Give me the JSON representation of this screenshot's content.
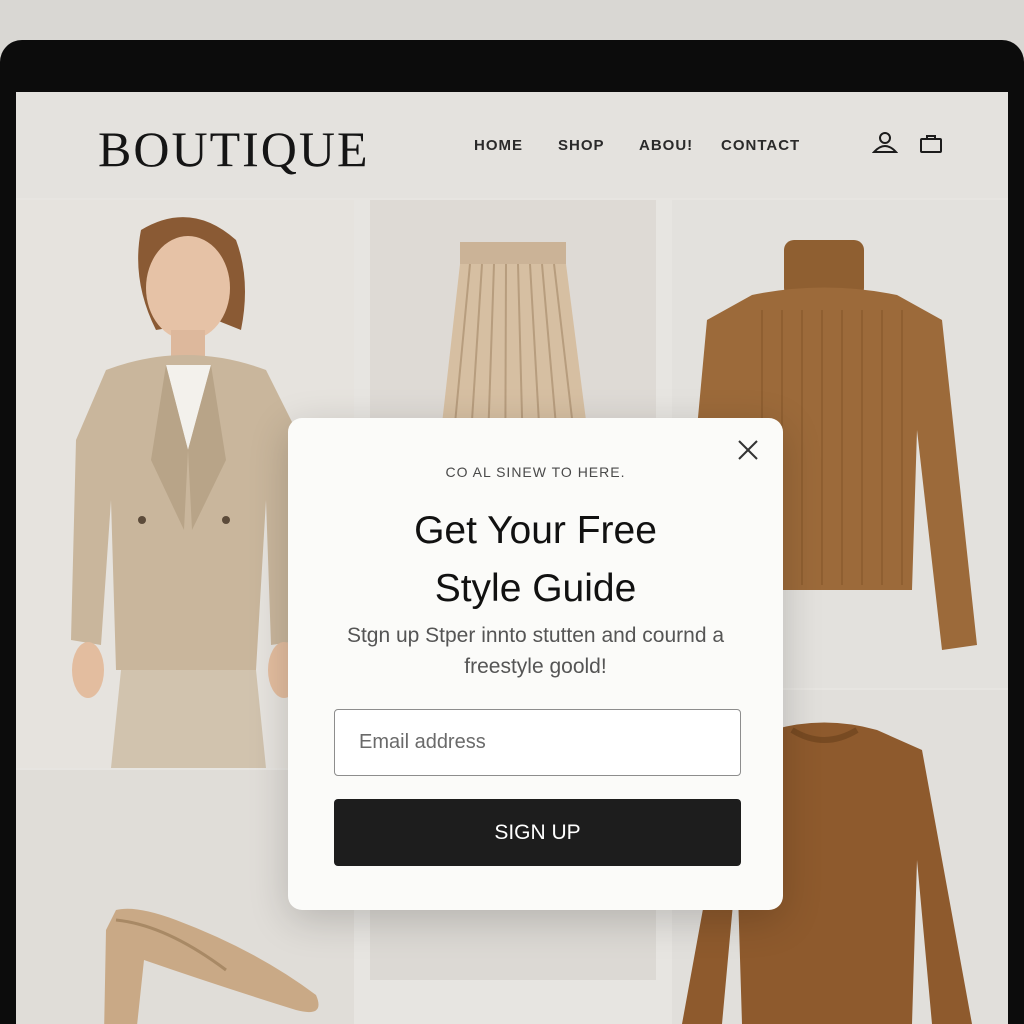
{
  "header": {
    "logo": "BOUTIQUE",
    "nav": [
      {
        "label": "HOME"
      },
      {
        "label": "SHOP"
      },
      {
        "label": "ABOU!"
      },
      {
        "label": "CONTACT"
      }
    ],
    "icons": [
      "account-icon",
      "cart-icon"
    ]
  },
  "products": [
    {
      "icon": "model-blazer-image"
    },
    {
      "icon": "pleated-skirt-image"
    },
    {
      "icon": "turtleneck-sweater-image"
    },
    {
      "icon": "pump-shoe-image"
    },
    {
      "icon": "crewneck-sweater-image"
    }
  ],
  "modal": {
    "eyebrow": "CO AL SINEW TO HERE.",
    "title": "Get Your Free\nStyle Guide",
    "subtitle": "Stgn up Stper innto stutten and cournd a freestyle goold!",
    "email_placeholder": "Email address",
    "button_label": "SIGN UP",
    "close_icon": "close-icon"
  },
  "colors": {
    "button": "#1d1d1d",
    "beige": "#c9b69c",
    "camel": "#9c6a3a",
    "background": "#e7e5e1"
  }
}
